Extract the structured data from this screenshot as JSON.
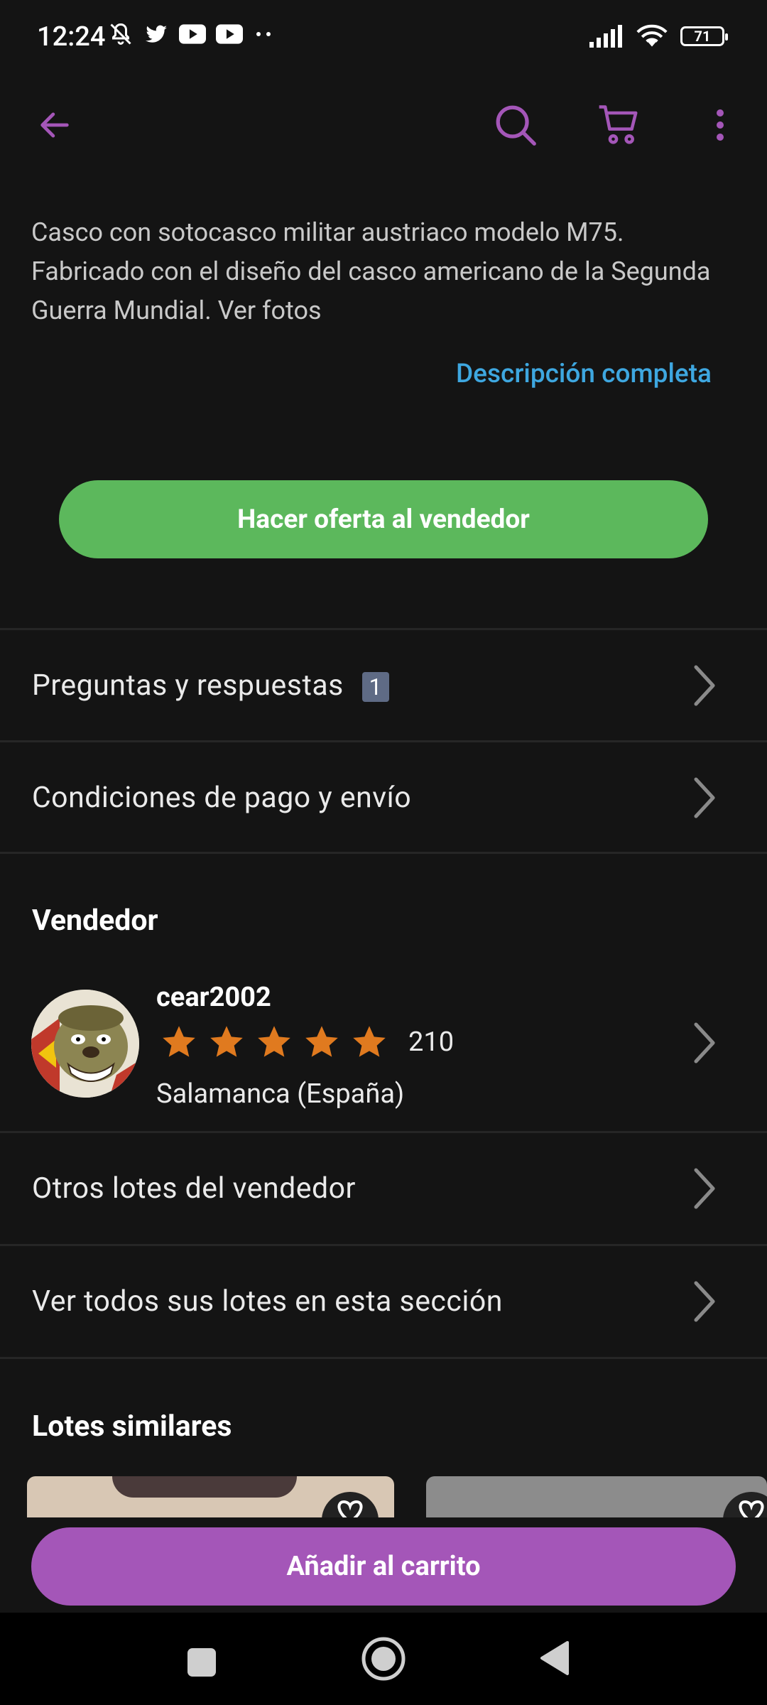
{
  "status_bar": {
    "time": "12:24",
    "battery": "71",
    "icons_left": [
      "mute-bell-icon",
      "twitter-icon",
      "youtube-icon",
      "youtube-icon",
      "more-dots-icon"
    ],
    "icons_right": [
      "signal-icon",
      "wifi-icon",
      "battery-icon"
    ]
  },
  "app_bar": {
    "icons": [
      "back-arrow-icon",
      "search-icon",
      "cart-icon",
      "overflow-menu-icon"
    ],
    "accent_color": "#a456b8"
  },
  "description": {
    "text": "Casco con sotocasco militar austriaco modelo M75. Fabricado con el diseño del casco americano de la Segunda Guerra Mundial. Ver fotos",
    "full_link": "Descripción completa"
  },
  "offer_button": "Hacer oferta al vendedor",
  "rows": {
    "questions": "Preguntas y respuestas",
    "questions_count": "1",
    "payment": "Condiciones de pago y envío",
    "other_lots": "Otros lotes del vendedor",
    "all_lots_section": "Ver todos sus lotes en esta sección"
  },
  "seller": {
    "section_title": "Vendedor",
    "name": "cear2002",
    "stars": 5,
    "rating_count": "210",
    "location": "Salamanca (España)"
  },
  "similar": {
    "title": "Lotes similares"
  },
  "cart_button": "Añadir al carrito",
  "nav_bar": {
    "icons": [
      "recents-square-icon",
      "home-circle-icon",
      "back-triangle-icon"
    ]
  },
  "colors": {
    "background": "#141414",
    "offer_green": "#5cb85c",
    "cart_purple": "#a456b8",
    "link_blue": "#3ea7e0",
    "star_orange": "#e07a1f"
  }
}
